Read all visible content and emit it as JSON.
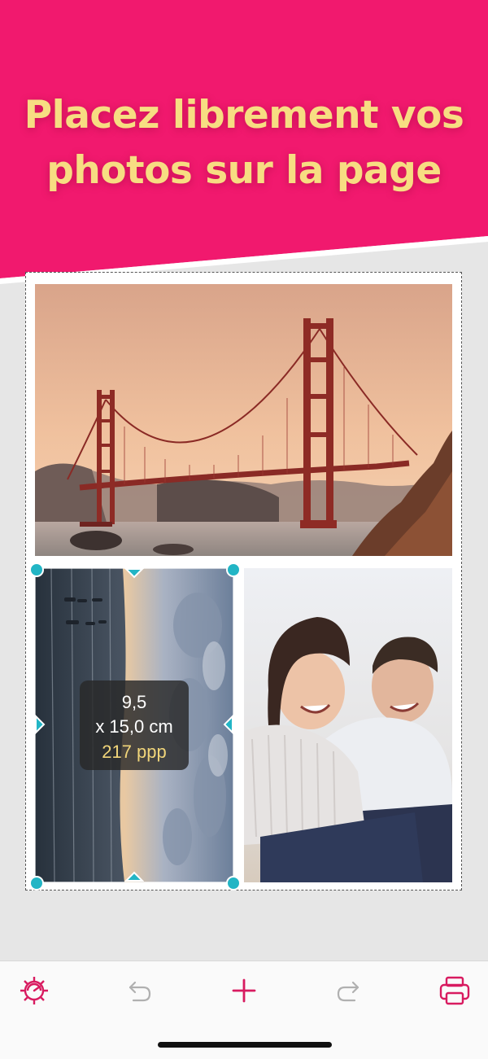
{
  "banner": {
    "line1": "Placez librement vos",
    "line2": "photos sur la page",
    "color": "#f1196e",
    "text_color": "#f7dd82"
  },
  "photos": [
    {
      "name": "golden-gate-bridge"
    },
    {
      "name": "beach-sunset",
      "selected": true
    },
    {
      "name": "laughing-couple"
    }
  ],
  "selection": {
    "handle_color": "#22b5c5",
    "size_line1": "9,5",
    "size_line2": "x 15,0 cm",
    "resolution": "217 ppp"
  },
  "toolbar": {
    "accent": "#d81b60",
    "items": [
      {
        "icon": "settings-icon"
      },
      {
        "icon": "undo-icon"
      },
      {
        "icon": "add-icon"
      },
      {
        "icon": "redo-icon"
      },
      {
        "icon": "print-icon"
      }
    ]
  }
}
